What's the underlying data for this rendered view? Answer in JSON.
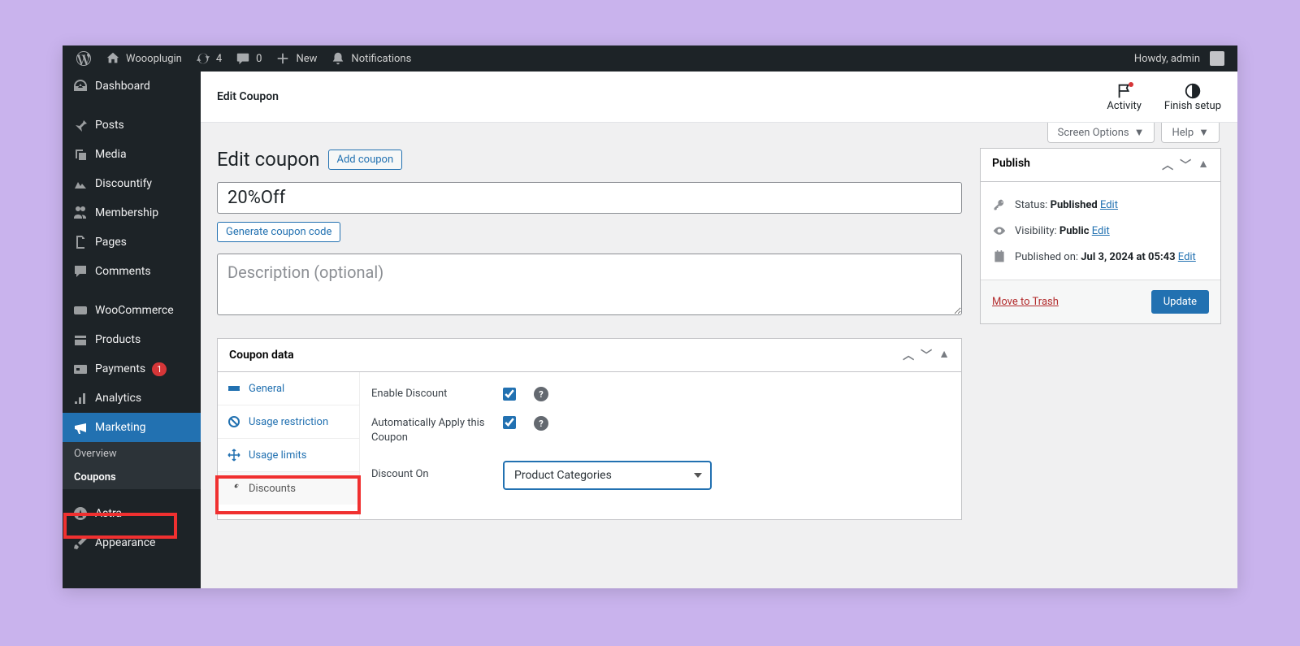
{
  "adminbar": {
    "site": "Woooplugin",
    "updates": "4",
    "comments": "0",
    "new": "New",
    "notifications": "Notifications",
    "howdy": "Howdy, admin"
  },
  "sidebar": {
    "items": [
      {
        "label": "Dashboard"
      },
      {
        "label": "Posts"
      },
      {
        "label": "Media"
      },
      {
        "label": "Discountify"
      },
      {
        "label": "Membership"
      },
      {
        "label": "Pages"
      },
      {
        "label": "Comments"
      },
      {
        "label": "WooCommerce"
      },
      {
        "label": "Products"
      },
      {
        "label": "Payments",
        "badge": "1"
      },
      {
        "label": "Analytics"
      },
      {
        "label": "Marketing"
      },
      {
        "label": "Astra"
      },
      {
        "label": "Appearance"
      }
    ],
    "subs": [
      {
        "label": "Overview"
      },
      {
        "label": "Coupons"
      }
    ]
  },
  "toprow": {
    "heading": "Edit Coupon",
    "activity": "Activity",
    "finish": "Finish setup"
  },
  "screenmeta": {
    "options": "Screen Options",
    "help": "Help"
  },
  "page": {
    "title": "Edit coupon",
    "add": "Add coupon",
    "coupon_value": "20%Off",
    "generate": "Generate coupon code",
    "desc_placeholder": "Description (optional)"
  },
  "coupon_data": {
    "title": "Coupon data",
    "tabs": [
      {
        "label": "General"
      },
      {
        "label": "Usage restriction"
      },
      {
        "label": "Usage limits"
      },
      {
        "label": "Discounts"
      }
    ],
    "fields": {
      "enable": "Enable Discount",
      "auto": "Automatically Apply this Coupon",
      "discount_on": "Discount On",
      "discount_on_value": "Product Categories"
    }
  },
  "publish": {
    "title": "Publish",
    "status_label": "Status:",
    "status_value": "Published",
    "visibility_label": "Visibility:",
    "visibility_value": "Public",
    "published_label": "Published on:",
    "published_value": "Jul 3, 2024 at 05:43",
    "edit": "Edit",
    "trash": "Move to Trash",
    "update": "Update"
  }
}
